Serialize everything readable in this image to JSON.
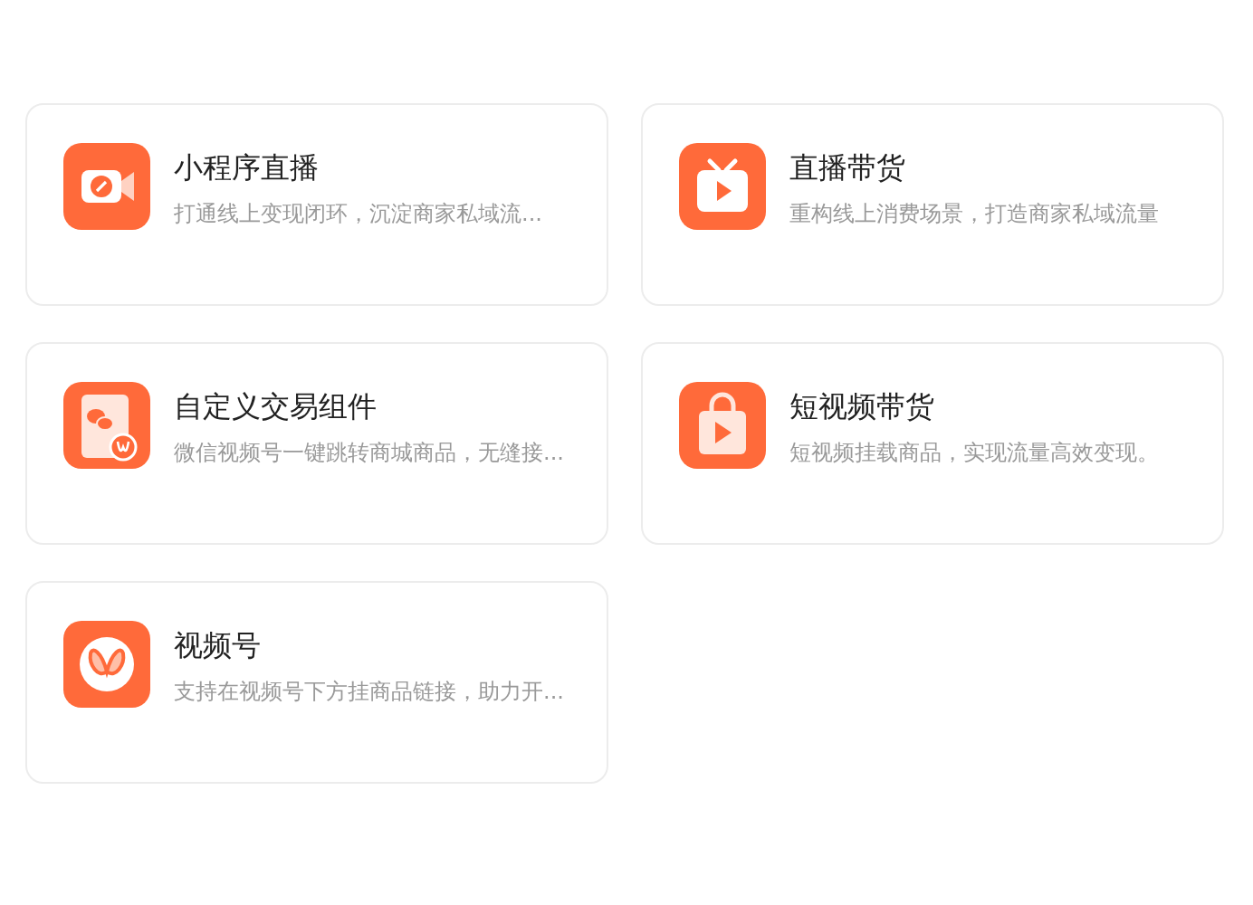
{
  "cards": [
    {
      "kind": "miniprogram-live",
      "title": "小程序直播",
      "description": "打通线上变现闭环，沉淀商家私域流..."
    },
    {
      "kind": "live-commerce",
      "title": "直播带货",
      "description": "重构线上消费场景，打造商家私域流量"
    },
    {
      "kind": "trade-component",
      "title": "自定义交易组件",
      "description": "微信视频号一键跳转商城商品，无缝接..."
    },
    {
      "kind": "short-video",
      "title": "短视频带货",
      "description": "短视频挂载商品，实现流量高效变现。"
    },
    {
      "kind": "channels",
      "title": "视频号",
      "description": "支持在视频号下方挂商品链接，助力开..."
    }
  ]
}
